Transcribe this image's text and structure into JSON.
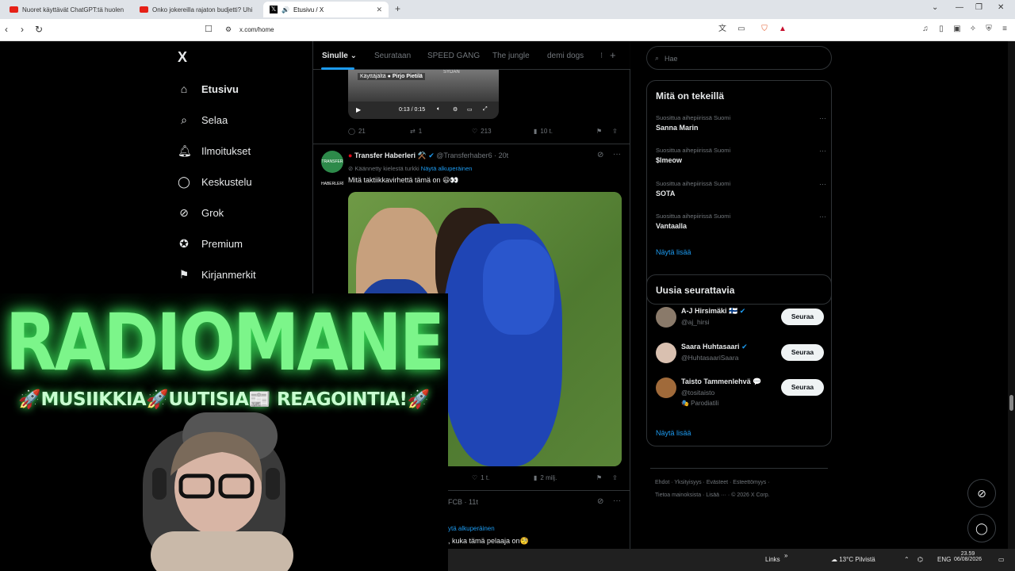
{
  "browser": {
    "tabs": [
      {
        "title": "Nuoret käyttävät ChatGPT:tä huolen",
        "favicon": "youtube-icon"
      },
      {
        "title": "Onko jokereilla rajaton budjetti? Uhi",
        "favicon": "youtube-icon"
      },
      {
        "title": "Etusivu / X",
        "favicon": "x-icon"
      }
    ],
    "url": "x.com/home"
  },
  "sidebar": {
    "logo": "X",
    "items": [
      {
        "label": "Etusivu",
        "icon": "home-icon"
      },
      {
        "label": "Selaa",
        "icon": "search-icon"
      },
      {
        "label": "Ilmoitukset",
        "icon": "bell-icon"
      },
      {
        "label": "Keskustelu",
        "icon": "chat-icon"
      },
      {
        "label": "Grok",
        "icon": "grok-icon"
      },
      {
        "label": "Premium",
        "icon": "verified-icon"
      },
      {
        "label": "Kirjanmerkit",
        "icon": "bookmark-icon"
      }
    ]
  },
  "feed_tabs": [
    "Sinulle",
    "Seurataan",
    "SPEED GANG",
    "The jungle",
    "demi dogs"
  ],
  "video1": {
    "tag": "Käyttäjältä",
    "tag_user": "Pirjo Pietilä",
    "tag_bg": "SYDÄN",
    "time": "0:13 / 0:15"
  },
  "tweet0_actions": {
    "replies": "21",
    "reposts": "1",
    "likes": "213",
    "views": "10 t."
  },
  "tweet1": {
    "avatar_text": "TRANSFER HABERLERİ",
    "name": "Transfer Haberleri ⚒️",
    "handle": "@Transferhaber6",
    "time": "20t",
    "translated": "Käännetty kielestä turkki",
    "show_original": "Näytä alkuperäinen",
    "text": "Mitä taktiikkavirhettä tämä on 😃👀",
    "likes": "1 t.",
    "views": "2 milj."
  },
  "tweet2": {
    "head": "FCB · 11t",
    "show_original": "ytä alkuperäinen",
    "text": ", kuka tämä pelaaja on🧐"
  },
  "search": {
    "placeholder": "Hae"
  },
  "trends": {
    "title": "Mitä on tekeillä",
    "items": [
      {
        "category": "Suosittua aihepiirissä Suomi",
        "name": "Sanna Marin"
      },
      {
        "category": "Suosittua aihepiirissä Suomi",
        "name": "$lmeow"
      },
      {
        "category": "Suosittua aihepiirissä Suomi",
        "name": "SOTA"
      },
      {
        "category": "Suosittua aihepiirissä Suomi",
        "name": "Vantaalla"
      }
    ],
    "show_more": "Näytä lisää"
  },
  "who_to_follow": {
    "title": "Uusia seurattavia",
    "items": [
      {
        "name": "A-J Hirsimäki 🇫🇮",
        "handle": "@aj_hirsi",
        "label": "",
        "button": "Seuraa",
        "color": "#8a7a6a"
      },
      {
        "name": "Saara Huhtasaari",
        "handle": "@HuhtasaariSaara",
        "label": "",
        "button": "Seuraa",
        "color": "#d9c0b0"
      },
      {
        "name": "Taisto Tammenlehvä 💬",
        "handle": "@tositaisto",
        "label": "🎭 Parodiatili",
        "button": "Seuraa",
        "color": "#a06a3a"
      }
    ],
    "show_more": "Näytä lisää"
  },
  "footer": {
    "line1": "Ehdot · Yksityisyys · Evästeet · Esteettömyys ·",
    "line2": "Tietoa mainoksista · Lisää ··· · © 2026 X Corp."
  },
  "overlay": {
    "brand": "RADIOMANE",
    "slogan": "🚀MUSIIKKIA🚀UUTISIA📰 REAGOINTIA!🚀"
  },
  "taskbar": {
    "links": "Links",
    "weather": "13°C Pilvistä",
    "lang": "ENG",
    "time": "23.59",
    "date": "06/08/2026"
  },
  "colors": {
    "accent": "#1d9bf0",
    "brand_glow": "#7cf58a"
  }
}
